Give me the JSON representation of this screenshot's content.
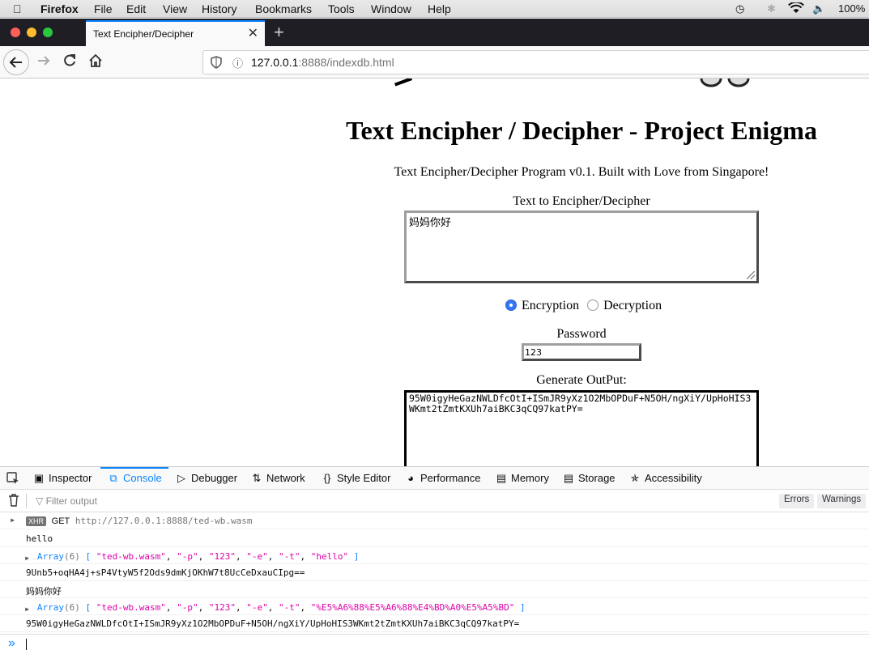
{
  "menubar": {
    "app": "Firefox",
    "items": [
      "File",
      "Edit",
      "View",
      "History",
      "Bookmarks",
      "Tools",
      "Window",
      "Help"
    ],
    "battery": "100%"
  },
  "tab": {
    "title": "Text Encipher/Decipher"
  },
  "address": {
    "host": "127.0.0.1",
    "rest": ":8888/indexdb.html"
  },
  "page": {
    "title": "Text Encipher / Decipher - Project Enigma",
    "subtitle": "Text Encipher/Decipher Program v0.1. Built with Love from Singapore!",
    "text_label": "Text to Encipher/Decipher",
    "text_value": "妈妈你好",
    "radio_encrypt": "Encryption",
    "radio_decrypt": "Decryption",
    "password_label": "Password",
    "password_value": "123",
    "output_label": "Generate OutPut:",
    "output_value": "95W0igyHeGazNWLDfcOtI+ISmJR9yXz1O2MbOPDuF+N5OH/ngXiY/UpHoHIS3WKmt2tZmtKXUh7aiBKC3qCQ97katPY="
  },
  "devtools": {
    "tabs": [
      "Inspector",
      "Console",
      "Debugger",
      "Network",
      "Style Editor",
      "Performance",
      "Memory",
      "Storage",
      "Accessibility"
    ],
    "filter_placeholder": "Filter output",
    "errors_btn": "Errors",
    "warnings_btn": "Warnings",
    "console": {
      "xhr_badge": "XHR",
      "xhr_method": "GET",
      "xhr_url": "http://127.0.0.1:8888/ted-wb.wasm",
      "log1": "hello",
      "array_label": "Array",
      "array_count": "(6)",
      "array1": [
        "\"ted-wb.wasm\"",
        "\"-p\"",
        "\"123\"",
        "\"-e\"",
        "\"-t\"",
        "\"hello\""
      ],
      "log2": "9Unb5+oqHA4j+sP4VtyW5f2Ods9dmKjOKhW7t8UcCeDxauCIpg==",
      "log3": "妈妈你好",
      "array2": [
        "\"ted-wb.wasm\"",
        "\"-p\"",
        "\"123\"",
        "\"-e\"",
        "\"-t\"",
        "\"%E5%A6%88%E5%A6%88%E4%BD%A0%E5%A5%BD\""
      ],
      "log4": "95W0igyHeGazNWLDfcOtI+ISmJR9yXz1O2MbOPDuF+N5OH/ngXiY/UpHoHIS3WKmt2tZmtKXUh7aiBKC3qCQ97katPY="
    }
  }
}
